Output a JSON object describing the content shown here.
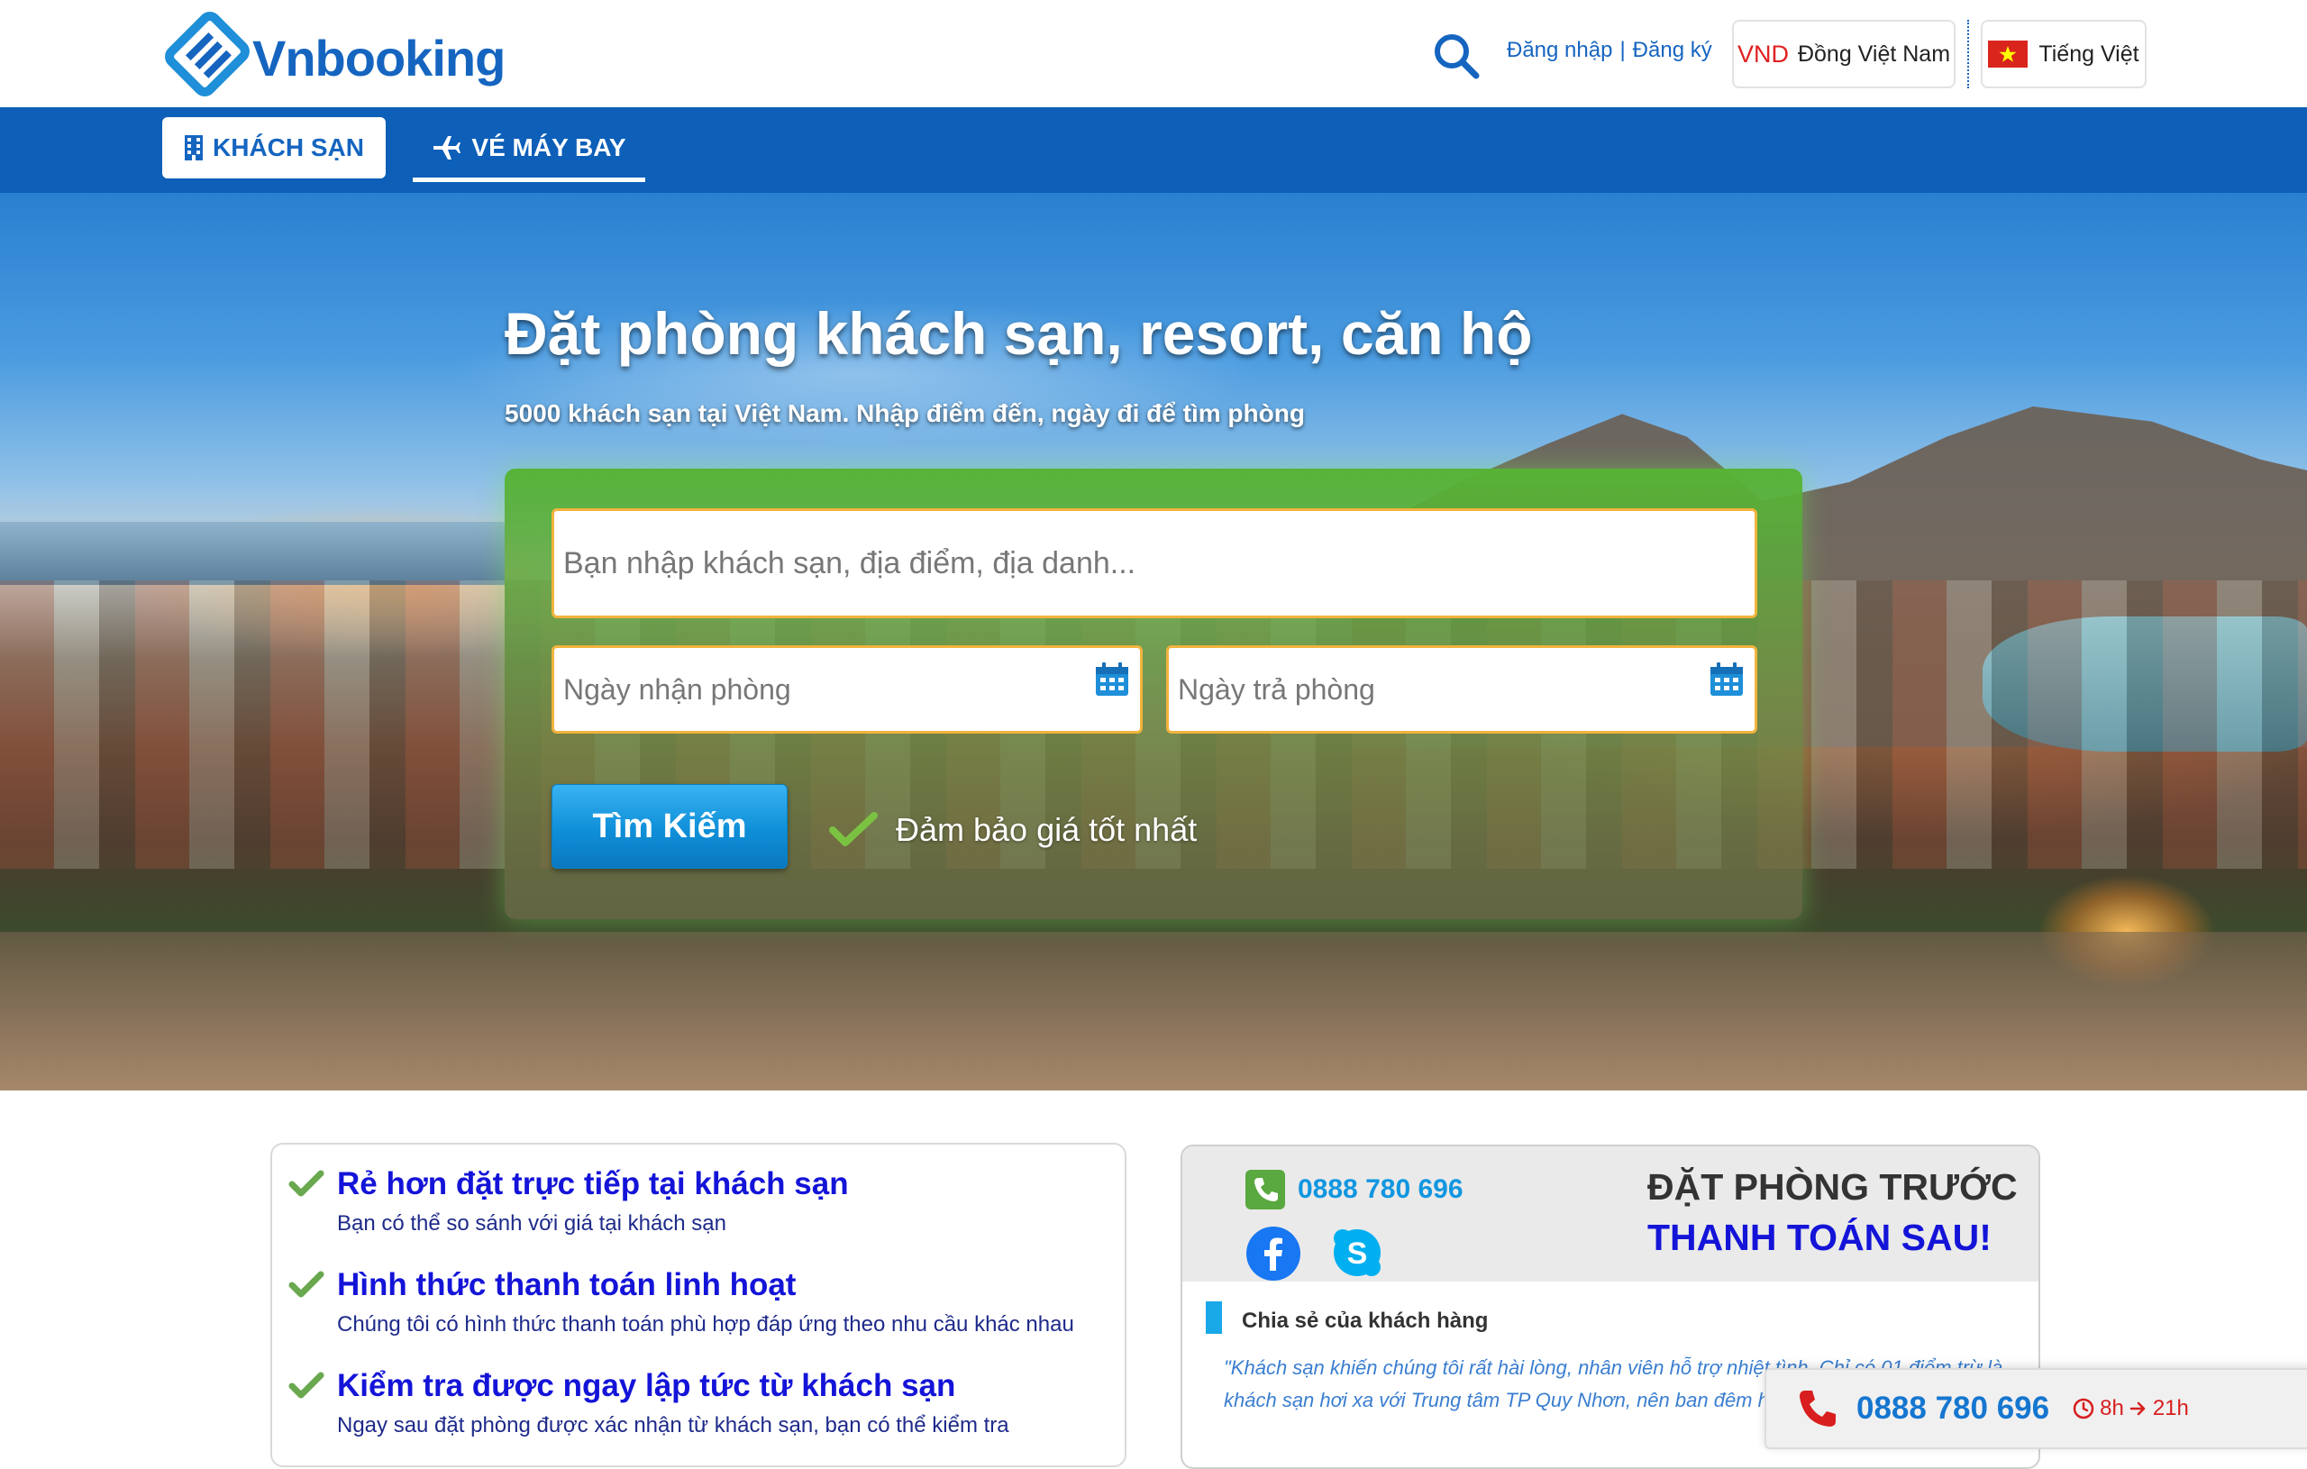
{
  "header": {
    "brand": "Vnbooking",
    "login": "Đăng nhập",
    "separator": "|",
    "register": "Đăng ký",
    "currency_code": "VND",
    "currency_name": "Đồng Việt Nam",
    "language": "Tiếng Việt"
  },
  "nav": {
    "tabs": [
      {
        "label": "KHÁCH SẠN",
        "active": true
      },
      {
        "label": "VÉ MÁY BAY",
        "active": false
      }
    ]
  },
  "hero": {
    "title": "Đặt phòng khách sạn, resort, căn hộ",
    "subtitle": "5000 khách sạn tại Việt Nam. Nhập điểm đến, ngày đi để tìm phòng"
  },
  "search": {
    "destination_placeholder": "Bạn nhập khách sạn, địa điểm, địa danh...",
    "checkin_placeholder": "Ngày nhận phòng",
    "checkout_placeholder": "Ngày trả phòng",
    "button_label": "Tìm Kiếm",
    "guarantee": "Đảm bảo giá tốt nhất"
  },
  "benefits": [
    {
      "title": "Rẻ hơn đặt trực tiếp tại khách sạn",
      "desc": "Bạn có thể so sánh với giá tại khách sạn"
    },
    {
      "title": "Hình thức thanh toán linh hoạt",
      "desc": "Chúng tôi có hình thức thanh toán phù hợp đáp ứng theo nhu cầu khác nhau"
    },
    {
      "title": "Kiểm tra được ngay lập tức từ khách sạn",
      "desc": "Ngay sau đặt phòng được xác nhận từ khách sạn, bạn có thể kiểm tra"
    }
  ],
  "contact": {
    "phone": "0888 780 696",
    "promo_line1": "ĐẶT PHÒNG TRƯỚC",
    "promo_line2": "THANH TOÁN SAU!",
    "share_title": "Chia sẻ của khách hàng",
    "share_quote": "\"Khách sạn khiến chúng tôi rất hài lòng, nhân viên hỗ trợ nhiệt tình. Chỉ có 01 điểm trừ là khách sạn hơi xa với Trung tâm TP Quy Nhơn, nên ban đêm hỗ trợ nhiệt tình.\""
  },
  "hotline": {
    "phone": "0888 780 696",
    "hours_from": "8h",
    "hours_to": "21h"
  },
  "colors": {
    "brand_blue": "#1565c0",
    "nav_blue": "#0d5fb8",
    "search_green": "#56b434",
    "input_border": "#f2b33d",
    "button_blue": "#0f8fd8",
    "benefit_title": "#1414d8",
    "check_green": "#6aa84f",
    "hotline_red": "#d81e1e"
  }
}
